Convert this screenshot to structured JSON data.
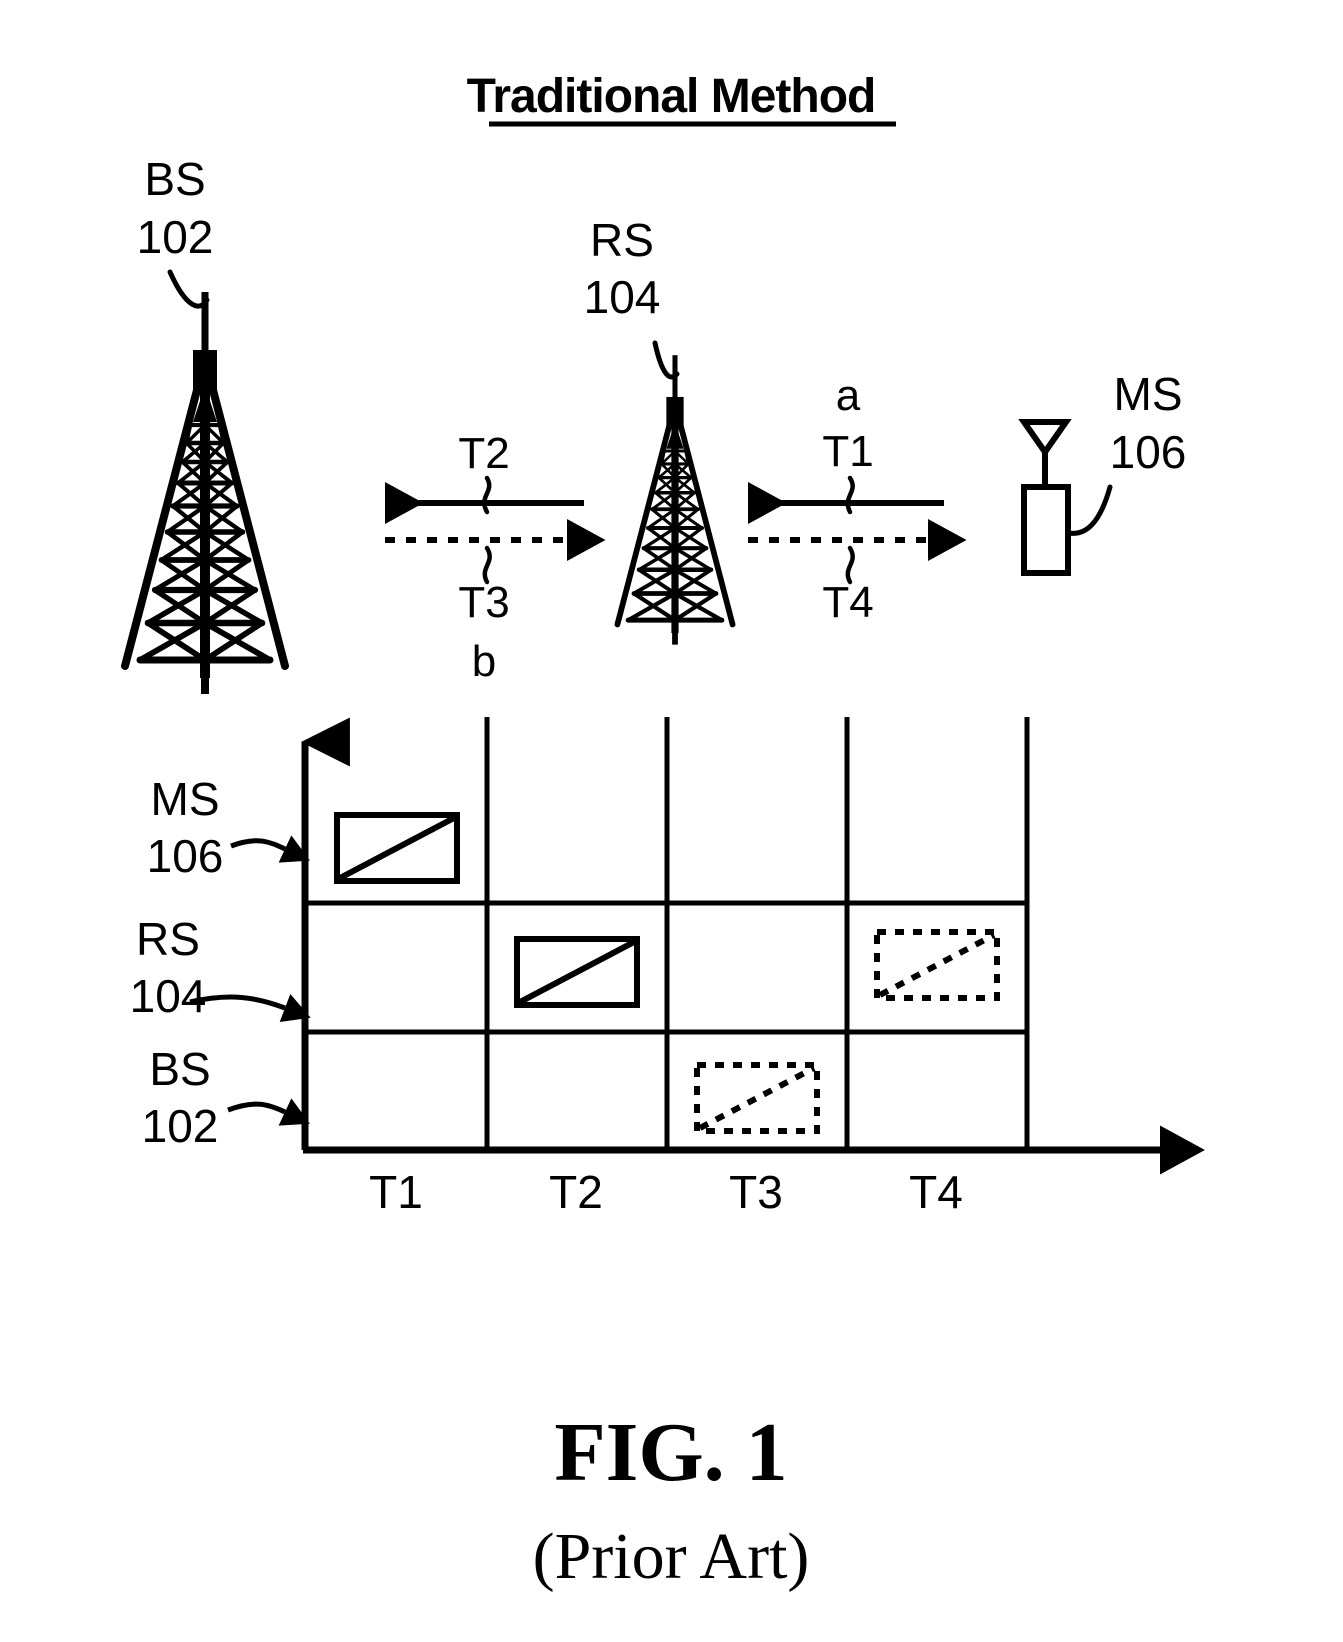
{
  "figure": {
    "title": "Traditional Method",
    "caption": "FIG. 1",
    "caption_sub": "(Prior Art)"
  },
  "topology": {
    "nodes": [
      {
        "id": "bs",
        "label": "BS",
        "number": "102",
        "icon": "tower-icon",
        "position": "left"
      },
      {
        "id": "rs",
        "label": "RS",
        "number": "104",
        "icon": "tower-icon",
        "position": "center"
      },
      {
        "id": "ms",
        "label": "MS",
        "number": "106",
        "icon": "mobile-station-icon",
        "position": "right"
      }
    ],
    "links": [
      {
        "id": "t2",
        "label": "T2",
        "style": "solid",
        "direction": "left",
        "segment": "bs-rs",
        "note": ""
      },
      {
        "id": "t3",
        "label": "T3",
        "style": "dashed",
        "direction": "right",
        "segment": "bs-rs",
        "note": "b"
      },
      {
        "id": "t1",
        "label": "T1",
        "style": "solid",
        "direction": "left",
        "segment": "rs-ms",
        "note": "a"
      },
      {
        "id": "t4",
        "label": "T4",
        "style": "dashed",
        "direction": "right",
        "segment": "rs-ms",
        "note": ""
      }
    ],
    "annotations": {
      "a": "a",
      "b": "b"
    }
  },
  "chart_data": {
    "type": "table",
    "title": "Traditional Method",
    "xlabel": "",
    "ylabel": "",
    "categories": [
      "T1",
      "T2",
      "T3",
      "T4"
    ],
    "rows": [
      {
        "name": "MS",
        "number": "106",
        "slots": [
          "solid",
          "",
          "",
          ""
        ]
      },
      {
        "name": "RS",
        "number": "104",
        "slots": [
          "",
          "solid",
          "",
          "dashed"
        ]
      },
      {
        "name": "BS",
        "number": "102",
        "slots": [
          "",
          "",
          "dashed",
          ""
        ]
      }
    ],
    "legend": [],
    "grid": true,
    "notes": "Each occupied slot is drawn as a rectangle with a diagonal line; solid outline = transmission, dashed outline = relayed/forwarded transmission."
  },
  "axis": {
    "x_ticks": [
      "T1",
      "T2",
      "T3",
      "T4"
    ],
    "y_row_labels": [
      {
        "label": "MS",
        "number": "106"
      },
      {
        "label": "RS",
        "number": "104"
      },
      {
        "label": "BS",
        "number": "102"
      }
    ]
  }
}
